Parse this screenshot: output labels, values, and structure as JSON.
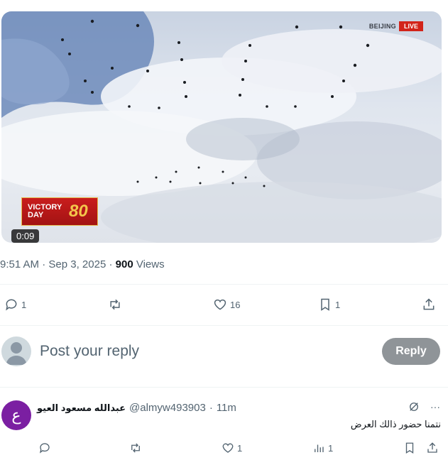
{
  "video": {
    "live_city": "BEIJING",
    "live_badge": "LIVE",
    "victory_text_line1": "VICTORY",
    "victory_text_line2": "DAY",
    "victory_number": "80",
    "duration": "0:09"
  },
  "meta": {
    "time": "9:51 AM",
    "separator": " · ",
    "date": "Sep 3, 2025",
    "views_count": "900",
    "views_label": " Views"
  },
  "actions": {
    "replies": "1",
    "reposts": "",
    "likes": "16",
    "bookmarks": "1"
  },
  "composer": {
    "placeholder": "Post your reply",
    "reply_button": "Reply"
  },
  "reply": {
    "avatar_letter": "ع",
    "name": "عبدالله مسعود العيو",
    "handle": "@almyw493903",
    "dot": "·",
    "time": "11m",
    "text": "نتمنا حضور ذالك العرض",
    "more": "···",
    "likes": "1",
    "views": "1"
  },
  "colors": {
    "accent_gray": "#536471",
    "reply_button": "#8f9498",
    "reply_avatar": "#7b1fa2",
    "live_red": "#d2241a"
  }
}
